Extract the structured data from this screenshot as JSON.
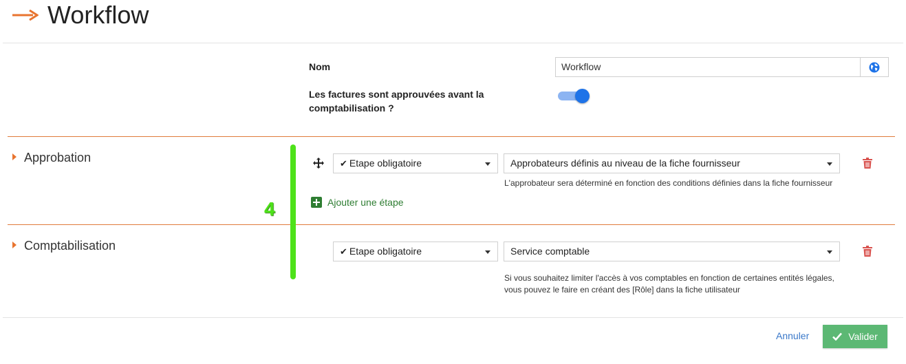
{
  "page": {
    "title": "Workflow"
  },
  "form": {
    "name_label": "Nom",
    "name_value": "Workflow",
    "approval_label_line1": "Les factures sont approuvées avant la",
    "approval_label_line2": "comptabilisation ?",
    "approval_toggle_on": true
  },
  "annotation": {
    "number": "4",
    "color": "#4ee21a"
  },
  "sections": [
    {
      "title": "Approbation",
      "step_type": "Etape obligatoire",
      "assignee": "Approbateurs définis au niveau de la fiche fournisseur",
      "help_line1": "L'approbateur sera déterminé en fonction des conditions définies dans la fiche fournisseur",
      "add_step_label": "Ajouter une étape"
    },
    {
      "title": "Comptabilisation",
      "step_type": "Etape obligatoire",
      "assignee": "Service comptable",
      "help_line1": "Si vous souhaitez limiter l'accès à vos comptables en fonction de certaines entités légales,",
      "help_line2": "vous pouvez le faire en créant des [Rôle] dans la fiche utilisateur"
    }
  ],
  "footer": {
    "cancel_label": "Annuler",
    "submit_label": "Valider"
  },
  "colors": {
    "accent_orange": "#e8742f",
    "primary_blue": "#1e73e8",
    "success_green": "#5cb874",
    "delete_red": "#d9534f",
    "link_blue": "#3a78c9"
  }
}
